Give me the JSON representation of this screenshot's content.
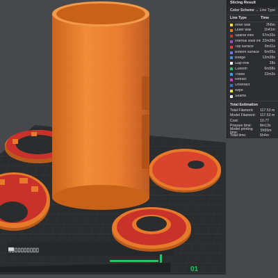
{
  "panel": {
    "title": "Slicing Result",
    "color_scheme_label": "Color Scheme",
    "color_scheme_value": "Line Type",
    "col_line_type": "Line Type",
    "col_time": "Time",
    "rows": [
      {
        "name": "Inner wall",
        "time": "2h6m",
        "color": "#ffdd44"
      },
      {
        "name": "Outer wall",
        "time": "1h41m",
        "color": "#f07a1a"
      },
      {
        "name": "Sparse infill",
        "time": "57m33s",
        "color": "#c0392b"
      },
      {
        "name": "Internal solid infill",
        "time": "22m39s",
        "color": "#a24fc7"
      },
      {
        "name": "Top surface",
        "time": "6m11s",
        "color": "#e23f3f"
      },
      {
        "name": "Bottom surface",
        "time": "6m55s",
        "color": "#6f74e6"
      },
      {
        "name": "Bridge",
        "time": "12m39s",
        "color": "#4a8ee0"
      },
      {
        "name": "Gap infill",
        "time": "28s",
        "color": "#ffffff"
      },
      {
        "name": "Custom",
        "time": "6m58s",
        "color": "#2ec26b"
      },
      {
        "name": "Travel",
        "time": "22m3s",
        "color": "#3aa0e8"
      },
      {
        "name": "Retract",
        "time": "",
        "color": "#d63ad6"
      },
      {
        "name": "Unretract",
        "time": "",
        "color": "#3a6fd6"
      },
      {
        "name": "Wipe",
        "time": "",
        "color": "#f2e33a"
      },
      {
        "name": "Seams",
        "time": "",
        "color": "#e8e8e8"
      }
    ],
    "total_title": "Total Estimation",
    "totals": [
      {
        "label": "Total Filament:",
        "value": "117.53 m"
      },
      {
        "label": "Model Filament:",
        "value": "117.53 m"
      },
      {
        "label": "Cost:",
        "value": "10.77"
      },
      {
        "label": "Prepare time:",
        "value": "8m13s"
      },
      {
        "label": "Model printing time:",
        "value": "5h55m"
      },
      {
        "label": "Total time:",
        "value": "6h4m"
      }
    ]
  },
  "bed": {
    "plate_number": "01",
    "colors": {
      "bed": "#2a2c2e",
      "orange": "#e67a2a",
      "red": "#c8322a",
      "accent": "#22c55e"
    }
  }
}
